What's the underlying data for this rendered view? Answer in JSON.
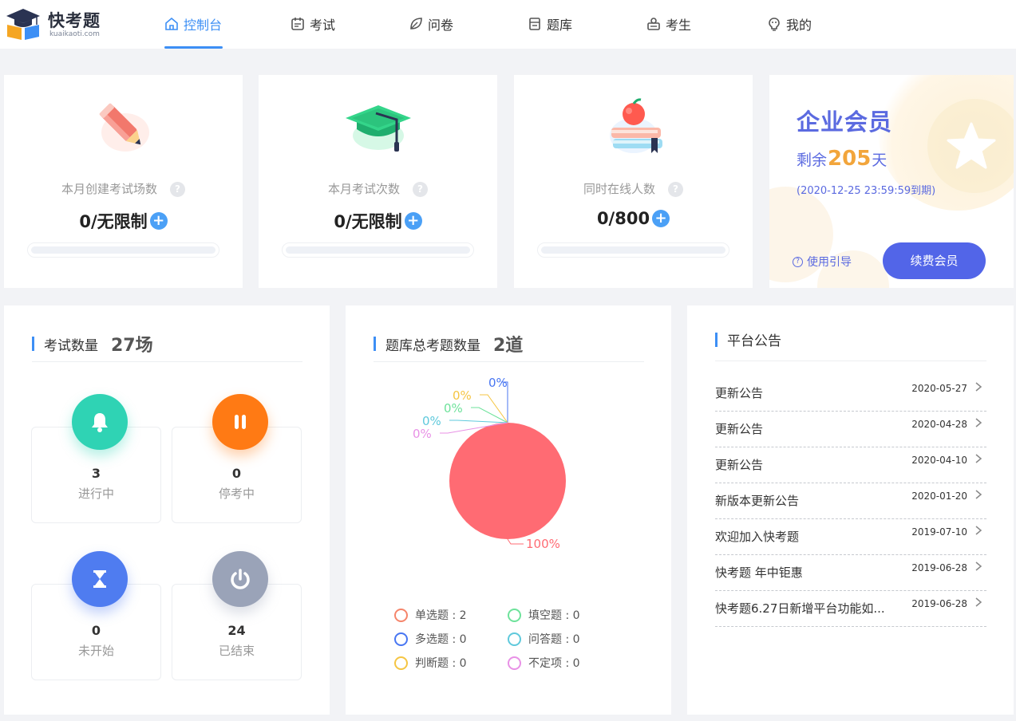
{
  "header": {
    "logo_text": "快考题",
    "logo_sub": "kuaikaoti.com",
    "nav": [
      {
        "label": "控制台",
        "icon": "home-icon",
        "active": true
      },
      {
        "label": "考试",
        "icon": "calendar-icon",
        "active": false
      },
      {
        "label": "问卷",
        "icon": "leaf-icon",
        "active": false
      },
      {
        "label": "题库",
        "icon": "book-icon",
        "active": false
      },
      {
        "label": "考生",
        "icon": "user-card-icon",
        "active": false
      },
      {
        "label": "我的",
        "icon": "lightbulb-icon",
        "active": false
      }
    ]
  },
  "stats": [
    {
      "label": "本月创建考试场数",
      "value": "0/无限制",
      "progress": 0,
      "icon": "pencil-icon"
    },
    {
      "label": "本月考试次数",
      "value": "0/无限制",
      "progress": 0,
      "icon": "graduation-cap-icon"
    },
    {
      "label": "同时在线人数",
      "value": "0/800",
      "progress": 0,
      "icon": "apple-books-icon"
    }
  ],
  "member": {
    "title": "企业会员",
    "remain_prefix": "剩余",
    "remain_days": "205",
    "remain_suffix": "天",
    "expire": "(2020-12-25 23:59:59到期)",
    "guide": "使用引导",
    "renew": "续费会员",
    "colors": {
      "primary": "#5265e8",
      "accent": "#f2a53b"
    }
  },
  "exams": {
    "title": "考试数量",
    "count": "27场",
    "items": [
      {
        "num": "3",
        "label": "进行中",
        "icon": "bell-icon",
        "color": "#2fd3b4"
      },
      {
        "num": "0",
        "label": "停考中",
        "icon": "pause-icon",
        "color": "#ff7a14"
      },
      {
        "num": "0",
        "label": "未开始",
        "icon": "hourglass-icon",
        "color": "#4f7cf0"
      },
      {
        "num": "24",
        "label": "已结束",
        "icon": "power-icon",
        "color": "#9aa3b8"
      }
    ]
  },
  "questions": {
    "title": "题库总考题数量",
    "count": "2道",
    "legend": [
      {
        "label": "单选题 : 2",
        "color": "#f5856b"
      },
      {
        "label": "填空题 : 0",
        "color": "#6ee29b"
      },
      {
        "label": "多选题 : 0",
        "color": "#4876f2"
      },
      {
        "label": "问答题 : 0",
        "color": "#5fc9dc"
      },
      {
        "label": "判断题 : 0",
        "color": "#f5c543"
      },
      {
        "label": "不定项 : 0",
        "color": "#e891e6"
      }
    ]
  },
  "chart_data": {
    "type": "pie",
    "categories": [
      "单选题",
      "多选题",
      "判断题",
      "填空题",
      "问答题",
      "不定项"
    ],
    "values": [
      2,
      0,
      0,
      0,
      0,
      0
    ],
    "labels": [
      "100%",
      "0%",
      "0%",
      "0%",
      "0%",
      "0%"
    ],
    "colors": [
      "#ff6b73",
      "#4876f2",
      "#f5c543",
      "#6ee29b",
      "#5fc9dc",
      "#e891e6"
    ]
  },
  "notices": {
    "title": "平台公告",
    "items": [
      {
        "title": "更新公告",
        "date": "2020-05-27"
      },
      {
        "title": "更新公告",
        "date": "2020-04-28"
      },
      {
        "title": "更新公告",
        "date": "2020-04-10"
      },
      {
        "title": "新版本更新公告",
        "date": "2020-01-20"
      },
      {
        "title": "欢迎加入快考题",
        "date": "2019-07-10"
      },
      {
        "title": "快考题 年中钜惠",
        "date": "2019-06-28"
      },
      {
        "title": "快考题6.27日新增平台功能如...",
        "date": "2019-06-28"
      }
    ]
  }
}
